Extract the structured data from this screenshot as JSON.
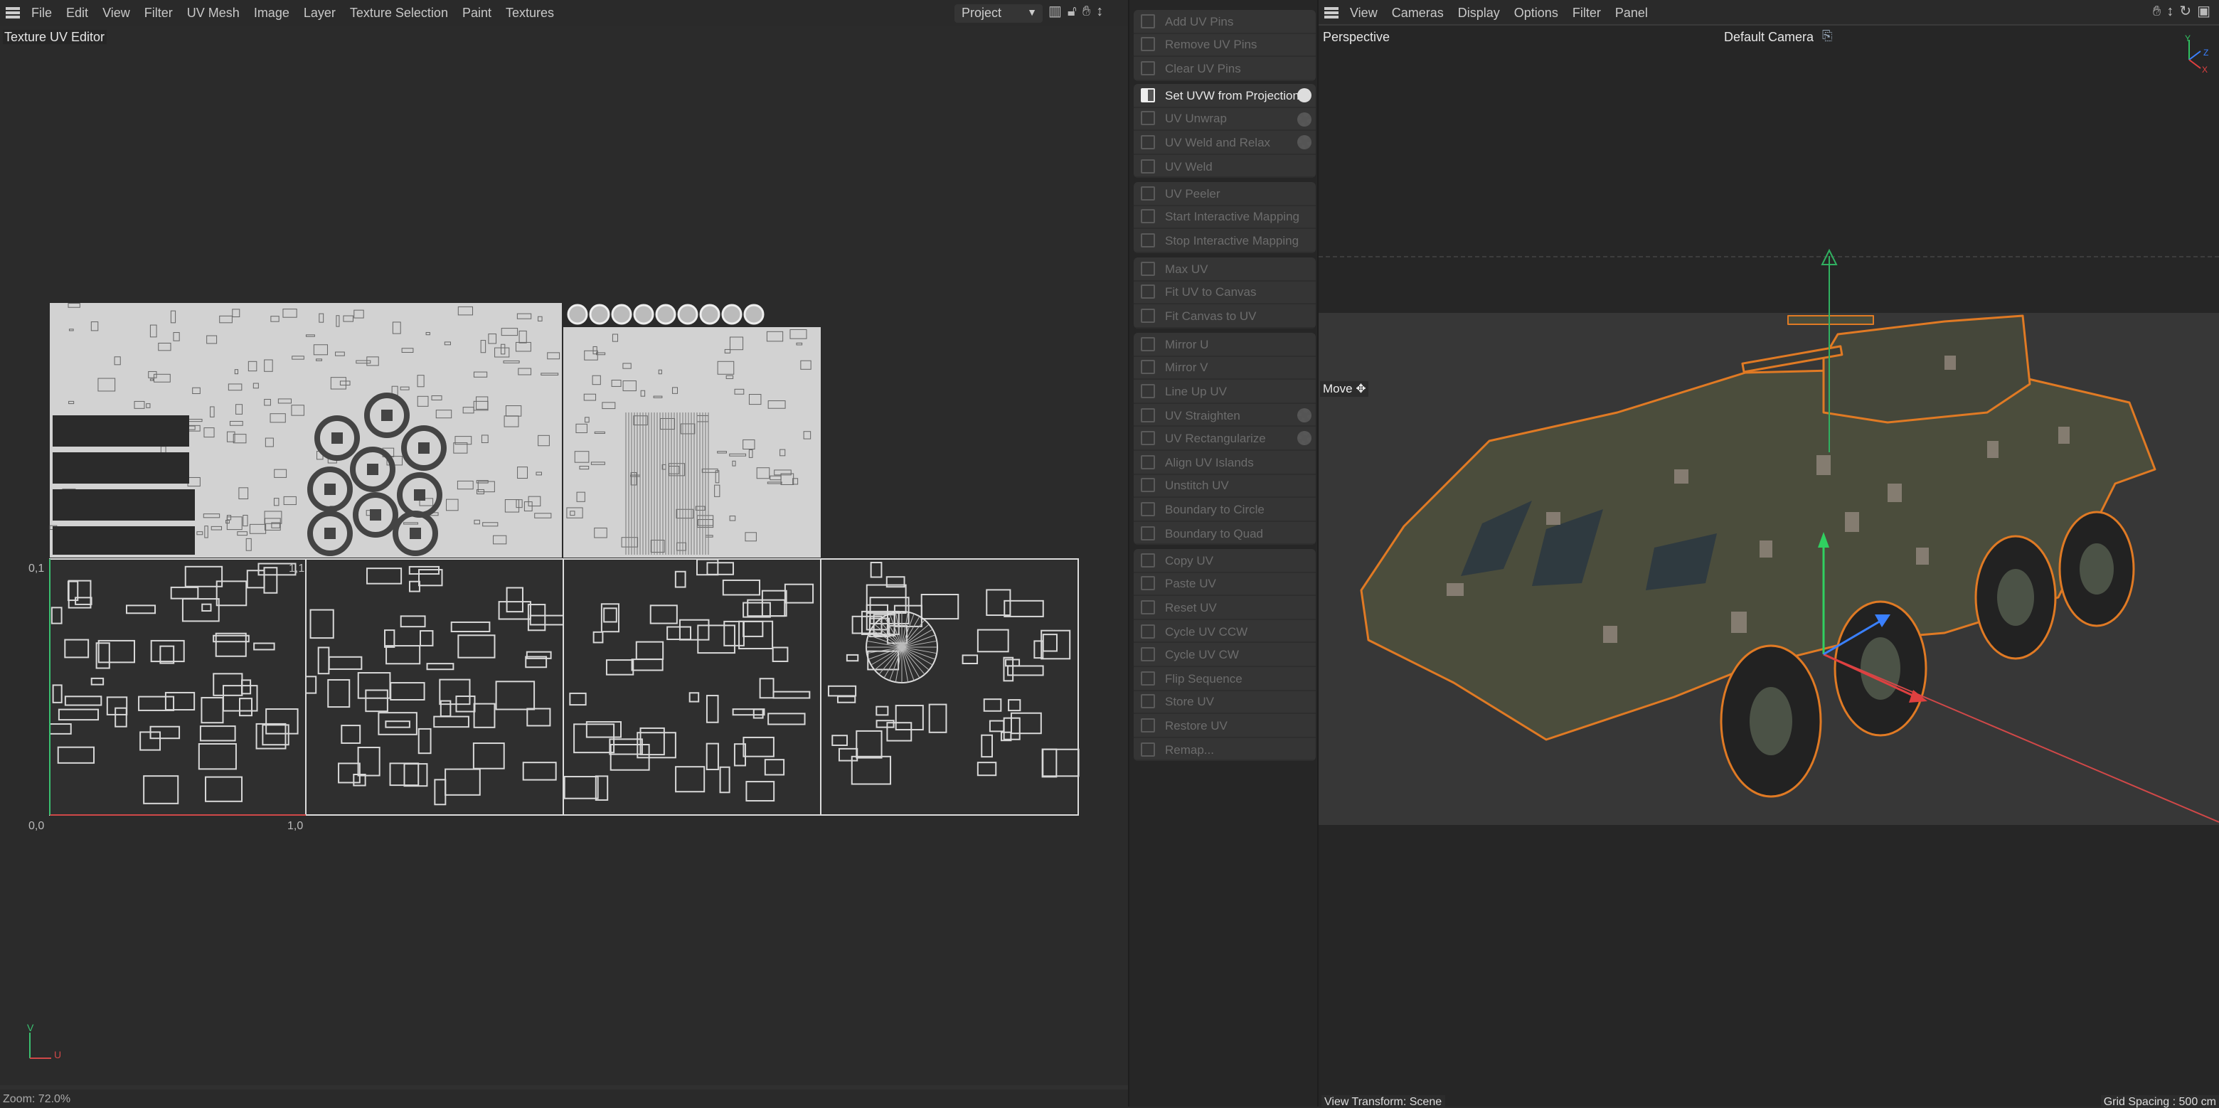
{
  "uv_editor": {
    "menu": [
      "File",
      "Edit",
      "View",
      "Filter",
      "UV Mesh",
      "Image",
      "Layer",
      "Texture Selection",
      "Paint",
      "Textures"
    ],
    "title": "Texture UV Editor",
    "project_select": "Project",
    "corner_labels": {
      "top_left": "0,1",
      "top_right": "1,1",
      "bottom_left": "0,0",
      "bottom_right": "1,0"
    },
    "axis": {
      "v": "V",
      "u": "U"
    },
    "zoom_status": "Zoom: 72.0%"
  },
  "uv_commands": {
    "groups": [
      [
        {
          "label": "Add UV Pins",
          "icon": "pin-icon"
        },
        {
          "label": "Remove UV Pins",
          "icon": "pin-remove-icon"
        },
        {
          "label": "Clear UV Pins",
          "icon": "close-icon"
        }
      ],
      [
        {
          "label": "Set UVW from Projection",
          "icon": "checker-icon",
          "enabled": true,
          "gear": true
        },
        {
          "label": "UV Unwrap",
          "icon": "unwrap-icon",
          "gear": true
        },
        {
          "label": "UV Weld and Relax",
          "icon": "weld-relax-icon",
          "gear": true
        },
        {
          "label": "UV Weld",
          "icon": "weld-icon"
        }
      ],
      [
        {
          "label": "UV Peeler",
          "icon": "peeler-icon"
        },
        {
          "label": "Start Interactive Mapping",
          "icon": "play-icon"
        },
        {
          "label": "Stop Interactive Mapping",
          "icon": "stop-icon"
        }
      ],
      [
        {
          "label": "Max UV",
          "icon": "max-uv-icon"
        },
        {
          "label": "Fit UV to Canvas",
          "icon": "fit-uv-icon"
        },
        {
          "label": "Fit Canvas to UV",
          "icon": "fit-canvas-icon"
        }
      ],
      [
        {
          "label": "Mirror U",
          "icon": "mirror-u-icon"
        },
        {
          "label": "Mirror V",
          "icon": "mirror-v-icon"
        },
        {
          "label": "Line Up UV",
          "icon": "line-up-icon"
        },
        {
          "label": "UV Straighten",
          "icon": "straighten-icon",
          "gear": true
        },
        {
          "label": "UV Rectangularize",
          "icon": "rectangularize-icon",
          "gear": true
        },
        {
          "label": "Align UV Islands",
          "icon": "align-icon"
        },
        {
          "label": "Unstitch UV",
          "icon": "unstitch-icon"
        },
        {
          "label": "Boundary to Circle",
          "icon": "circle-icon"
        },
        {
          "label": "Boundary to Quad",
          "icon": "quad-icon"
        }
      ],
      [
        {
          "label": "Copy UV",
          "icon": "copy-icon"
        },
        {
          "label": "Paste UV",
          "icon": "paste-icon"
        },
        {
          "label": "Reset UV",
          "icon": "reset-icon"
        },
        {
          "label": "Cycle UV CCW",
          "icon": "ccw-icon"
        },
        {
          "label": "Cycle UV CW",
          "icon": "cw-icon"
        },
        {
          "label": "Flip Sequence",
          "icon": "flip-icon"
        },
        {
          "label": "Store UV",
          "icon": "store-icon"
        },
        {
          "label": "Restore UV",
          "icon": "restore-icon"
        },
        {
          "label": "Remap...",
          "icon": "remap-icon"
        }
      ]
    ]
  },
  "viewport": {
    "menu": [
      "View",
      "Cameras",
      "Display",
      "Options",
      "Filter",
      "Panel"
    ],
    "projection": "Perspective",
    "camera": "Default Camera",
    "tool": "Move",
    "axes": {
      "x": "X",
      "y": "Y",
      "z": "Z"
    },
    "view_transform": "View Transform: Scene",
    "grid_spacing": "Grid Spacing : 500 cm",
    "colors": {
      "selection": "#e07a24",
      "x_axis": "#e04040",
      "y_axis": "#30d060",
      "z_axis": "#3a80ff",
      "body": "#4b4d3c"
    }
  }
}
